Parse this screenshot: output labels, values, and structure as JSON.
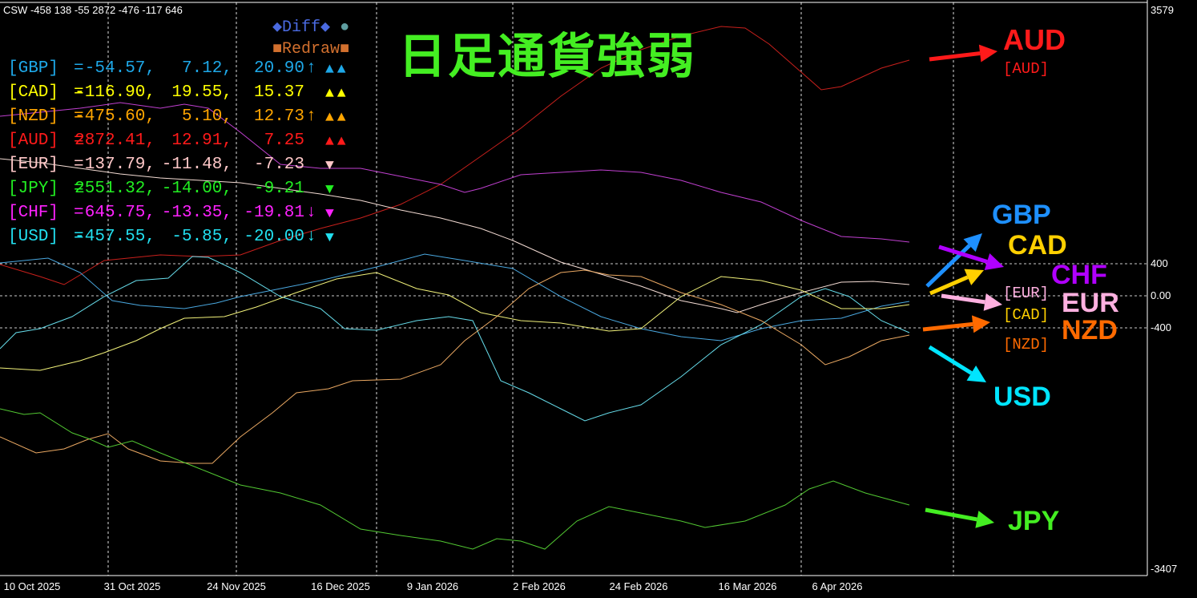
{
  "header": {
    "csw_text": "CSW -458 138 -55 2872 -476 -117 646"
  },
  "title": "日足通貨強弱",
  "controls": {
    "diff_label": "◆Diff◆",
    "diff_dot": "●",
    "redraw_label": "■Redraw■"
  },
  "table": [
    {
      "name": "[GBP]",
      "eq": "=",
      "v1": "-54.57,",
      "v2": "7.12,",
      "v3": "20.90",
      "arrow": "↑",
      "tri": "▲▲",
      "color": "#1ea8e8"
    },
    {
      "name": "[CAD]",
      "eq": "=",
      "v1": "-116.90,",
      "v2": "19.55,",
      "v3": "15.37",
      "arrow": "",
      "tri": "▲▲",
      "color": "#ffff00"
    },
    {
      "name": "[NZD]",
      "eq": "=",
      "v1": "-475.60,",
      "v2": "5.10,",
      "v3": "12.73",
      "arrow": "↑",
      "tri": "▲▲",
      "color": "#ffa500"
    },
    {
      "name": "[AUD]",
      "eq": "=",
      "v1": "2872.41,",
      "v2": "12.91,",
      "v3": "7.25",
      "arrow": "",
      "tri": "▲▲",
      "color": "#ff1a1a"
    },
    {
      "name": "[EUR]",
      "eq": "=",
      "v1": "137.79,",
      "v2": "-11.48,",
      "v3": "-7.23",
      "arrow": "",
      "tri": "▼",
      "color": "#ffc8c8"
    },
    {
      "name": "[JPY]",
      "eq": "=",
      "v1": "2551.32,",
      "v2": "-14.00,",
      "v3": "-9.21",
      "arrow": "",
      "tri": "▼",
      "color": "#22ee22"
    },
    {
      "name": "[CHF]",
      "eq": "=",
      "v1": "645.75,",
      "v2": "-13.35,",
      "v3": "-19.81",
      "arrow": "↓",
      "tri": "▼",
      "color": "#ff22ff"
    },
    {
      "name": "[USD]",
      "eq": "=",
      "v1": "-457.55,",
      "v2": "-5.85,",
      "v3": "-20.00",
      "arrow": "↓",
      "tri": "▼",
      "color": "#22e0f0"
    }
  ],
  "annotations": {
    "AUD": {
      "label": "AUD",
      "tag": "[AUD]",
      "color": "#ff1a1a"
    },
    "GBP": {
      "label": "GBP",
      "color": "#1e90ff"
    },
    "CAD": {
      "label": "CAD",
      "tag": "[CAD]",
      "color": "#ffd000"
    },
    "CHF": {
      "label": "CHF",
      "color": "#b000ff"
    },
    "EUR": {
      "label": "EUR",
      "tag": "[EUR]",
      "color": "#ffb0e0"
    },
    "NZD": {
      "label": "NZD",
      "tag": "[NZD]",
      "color": "#ff6a00"
    },
    "USD": {
      "label": "USD",
      "color": "#00e5ff"
    },
    "JPY": {
      "label": "JPY",
      "color": "#44ee22"
    }
  },
  "chart_data": {
    "type": "line",
    "title": "日足通貨強弱",
    "xlabel": "",
    "ylabel": "",
    "x_unit": "bar",
    "ylim": [
      -3407,
      3579
    ],
    "y_ticks": [
      {
        "value": 3579,
        "label": "3579"
      },
      {
        "value": 400,
        "label": "400"
      },
      {
        "value": 0,
        "label": "0.00"
      },
      {
        "value": -400,
        "label": "-400"
      },
      {
        "value": -3407,
        "label": "-3407"
      }
    ],
    "h_grid": [
      400,
      0,
      -400
    ],
    "x_ticks": [
      {
        "bar": 8,
        "label": "10 Oct 2025"
      },
      {
        "bar": 33,
        "label": "31 Oct 2025"
      },
      {
        "bar": 59,
        "label": "24 Nov 2025"
      },
      {
        "bar": 85,
        "label": "16 Dec 2025"
      },
      {
        "bar": 108,
        "label": "9 Jan 2026"
      },
      {
        "bar": 134.6,
        "label": "2 Feb 2026"
      },
      {
        "bar": 159.4,
        "label": "24 Feb 2026"
      },
      {
        "bar": 186.6,
        "label": "16 Mar 2026"
      },
      {
        "bar": 209,
        "label": "6 Apr 2026"
      }
    ],
    "v_grid_bars": [
      27,
      59,
      94,
      128,
      200,
      238
    ],
    "series": [
      {
        "name": "AUD",
        "color": "#c8201c",
        "x": [
          0,
          10,
          16,
          26,
          40,
          50,
          60,
          70,
          80,
          90,
          100,
          110,
          120,
          130,
          140,
          150,
          160,
          170,
          180,
          186,
          192,
          200,
          205,
          210,
          220,
          227
        ],
        "y": [
          390,
          240,
          140,
          440,
          510,
          490,
          510,
          690,
          840,
          970,
          1140,
          1390,
          1740,
          2090,
          2490,
          2840,
          3070,
          3240,
          3360,
          3340,
          3140,
          2790,
          2570,
          2610,
          2840,
          2940
        ]
      },
      {
        "name": "CHF",
        "color": "#c040d0",
        "x": [
          0,
          10,
          20,
          30,
          40,
          46,
          52,
          60,
          70,
          80,
          90,
          100,
          110,
          116,
          120,
          130,
          140,
          150,
          160,
          170,
          180,
          190,
          200,
          210,
          220,
          227
        ],
        "y": [
          2240,
          2290,
          2340,
          2410,
          2340,
          2390,
          2340,
          2040,
          1640,
          1590,
          1590,
          1490,
          1390,
          1290,
          1340,
          1510,
          1540,
          1570,
          1540,
          1440,
          1290,
          1170,
          940,
          740,
          710,
          670
        ]
      },
      {
        "name": "EUR",
        "color": "#f4dcd4",
        "x": [
          0,
          10,
          20,
          30,
          40,
          50,
          60,
          70,
          80,
          90,
          100,
          110,
          120,
          128,
          140,
          150,
          160,
          170,
          180,
          184,
          190,
          200,
          210,
          218,
          227
        ],
        "y": [
          1710,
          1660,
          1590,
          1520,
          1470,
          1440,
          1410,
          1340,
          1270,
          1190,
          1070,
          970,
          840,
          690,
          420,
          270,
          120,
          -60,
          -160,
          -210,
          -110,
          40,
          170,
          180,
          140
        ]
      },
      {
        "name": "GBP",
        "color": "#4aa8e0",
        "x": [
          0,
          12,
          20,
          28,
          35,
          46,
          54,
          60,
          70,
          80,
          94,
          106,
          116,
          128,
          140,
          150,
          160,
          170,
          180,
          190,
          200,
          210,
          220,
          227
        ],
        "y": [
          410,
          470,
          290,
          -60,
          -120,
          -160,
          -90,
          -10,
          90,
          190,
          360,
          520,
          440,
          340,
          -10,
          -260,
          -410,
          -510,
          -560,
          -410,
          -310,
          -280,
          -130,
          -70
        ]
      },
      {
        "name": "USD",
        "color": "#66dcea",
        "x": [
          0,
          4,
          10,
          18,
          26,
          34,
          42,
          48,
          52,
          60,
          70,
          80,
          86,
          94,
          104,
          112,
          118,
          125,
          132,
          140,
          146,
          152,
          160,
          170,
          180,
          190,
          200,
          206,
          212,
          220,
          227
        ],
        "y": [
          -660,
          -460,
          -410,
          -260,
          -10,
          190,
          220,
          490,
          480,
          290,
          -10,
          -160,
          -410,
          -430,
          -310,
          -260,
          -310,
          -1060,
          -1210,
          -1410,
          -1560,
          -1460,
          -1360,
          -1010,
          -610,
          -360,
          -10,
          90,
          -10,
          -310,
          -460
        ]
      },
      {
        "name": "CAD",
        "color": "#f2f27a",
        "x": [
          0,
          10,
          20,
          26,
          34,
          40,
          46,
          56,
          64,
          74,
          84,
          94,
          104,
          112,
          120,
          130,
          140,
          152,
          160,
          170,
          180,
          190,
          200,
          210,
          220,
          227
        ],
        "y": [
          -900,
          -930,
          -810,
          -710,
          -560,
          -410,
          -280,
          -260,
          -140,
          40,
          210,
          290,
          90,
          10,
          -210,
          -310,
          -340,
          -440,
          -410,
          -10,
          240,
          190,
          70,
          -160,
          -160,
          -110
        ]
      },
      {
        "name": "NZD",
        "color": "#eaa862",
        "x": [
          0,
          9,
          16,
          22,
          27,
          32,
          40,
          48,
          53,
          60,
          68,
          74,
          82,
          88,
          100,
          110,
          116,
          124,
          132,
          140,
          146,
          152,
          160,
          170,
          180,
          190,
          200,
          206,
          212,
          220,
          227
        ],
        "y": [
          -1760,
          -1960,
          -1910,
          -1790,
          -1720,
          -1910,
          -2060,
          -2090,
          -2090,
          -1760,
          -1460,
          -1210,
          -1160,
          -1060,
          -1040,
          -860,
          -560,
          -260,
          90,
          290,
          320,
          260,
          240,
          40,
          -110,
          -310,
          -610,
          -860,
          -760,
          -560,
          -490
        ]
      },
      {
        "name": "JPY",
        "color": "#52c832",
        "x": [
          0,
          6,
          10,
          18,
          22,
          27,
          33,
          40,
          50,
          60,
          70,
          80,
          90,
          100,
          110,
          118,
          124,
          130,
          136,
          144,
          152,
          160,
          170,
          176,
          186,
          196,
          202,
          208,
          216,
          227
        ],
        "y": [
          -1410,
          -1480,
          -1460,
          -1710,
          -1780,
          -1890,
          -1810,
          -1960,
          -2160,
          -2360,
          -2460,
          -2610,
          -2910,
          -2990,
          -3060,
          -3160,
          -3030,
          -3060,
          -3160,
          -2810,
          -2630,
          -2710,
          -2810,
          -2890,
          -2810,
          -2610,
          -2410,
          -2310,
          -2460,
          -2610
        ]
      }
    ]
  }
}
